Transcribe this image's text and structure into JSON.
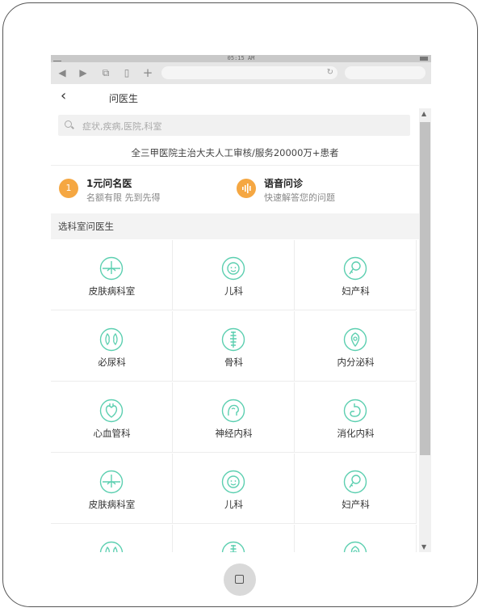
{
  "status": {
    "time": "05:15 AM"
  },
  "header": {
    "back_icon": "chevron-left-icon",
    "title": "问医生"
  },
  "search": {
    "placeholder": "症状,疾病,医院,科室"
  },
  "banner": "全三甲医院主治大夫人工审核/服务20000万+患者",
  "promos": [
    {
      "title": "1元问名医",
      "subtitle": "名额有限 先到先得",
      "icon": "coin-icon",
      "icon_text": "1"
    },
    {
      "title": "语音问诊",
      "subtitle": "快速解答您的问题",
      "icon": "voice-icon"
    }
  ],
  "section_title": "选科室问医生",
  "departments": [
    {
      "label": "皮肤病科室",
      "icon": "skin-icon"
    },
    {
      "label": "儿科",
      "icon": "baby-icon"
    },
    {
      "label": "妇产科",
      "icon": "gynecology-icon"
    },
    {
      "label": "必尿科",
      "icon": "kidney-icon"
    },
    {
      "label": "骨科",
      "icon": "spine-icon"
    },
    {
      "label": "内分泌科",
      "icon": "endocrine-icon"
    },
    {
      "label": "心血管科",
      "icon": "heart-icon"
    },
    {
      "label": "神经内科",
      "icon": "brain-icon"
    },
    {
      "label": "消化内科",
      "icon": "stomach-icon"
    },
    {
      "label": "皮肤病科室",
      "icon": "skin-icon"
    },
    {
      "label": "儿科",
      "icon": "baby-icon"
    },
    {
      "label": "妇产科",
      "icon": "gynecology-icon"
    },
    {
      "label": "",
      "icon": "kidney-icon"
    },
    {
      "label": "",
      "icon": "spine-icon"
    },
    {
      "label": "",
      "icon": "endocrine-icon"
    }
  ],
  "colors": {
    "accent": "#5ccfb0",
    "promo": "#f5a742",
    "section_bg": "#f3f3f3"
  }
}
